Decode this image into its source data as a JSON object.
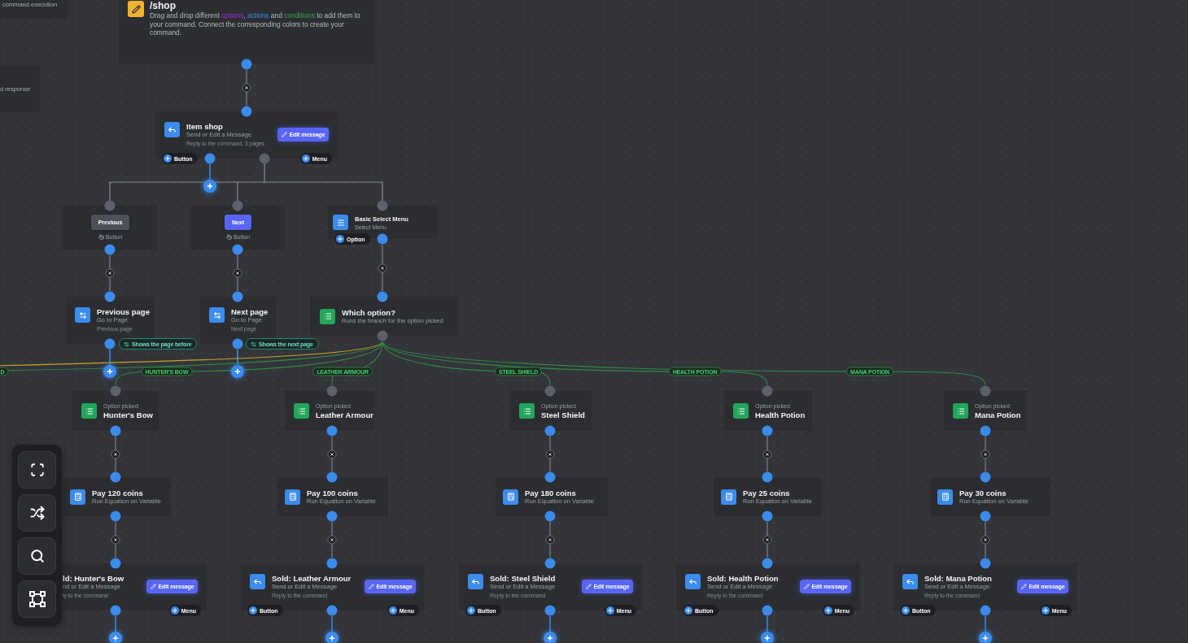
{
  "partial_nodes": [
    {
      "text": "command execution"
    },
    {
      "text": "d response"
    }
  ],
  "command": {
    "title": "/shop",
    "description": [
      {
        "kind": "text",
        "text": "Drag and drop different "
      },
      {
        "kind": "option",
        "text": "options"
      },
      {
        "kind": "text",
        "text": ", "
      },
      {
        "kind": "action",
        "text": "actions"
      },
      {
        "kind": "text",
        "text": " and "
      },
      {
        "kind": "condition",
        "text": "conditions"
      },
      {
        "kind": "text",
        "text": " to add them to your command. Connect the corresponding colors to create your command."
      }
    ]
  },
  "nodes": [
    {
      "kind": "message",
      "title": "Item shop",
      "subtitle": "Send or Edit a Message",
      "note": "Reply to the command, 3 pages",
      "edit_button": "Edit message",
      "button_pill": "Button",
      "menu_pill": "Menu"
    },
    {
      "kind": "button",
      "button": {
        "label": "Previous",
        "kind": "secondary"
      },
      "caption": "Button"
    },
    {
      "kind": "button",
      "button": {
        "label": "Next",
        "kind": "primary"
      },
      "caption": "Button"
    },
    {
      "kind": "select_menu",
      "title": "Basic Select Menu",
      "subtitle": "Select Menu",
      "option_pill": "Option"
    },
    {
      "kind": "action",
      "title": "Previous page",
      "subtitle": "Go to Page",
      "note": "Previous page"
    },
    {
      "kind": "action",
      "title": "Next page",
      "subtitle": "Go to Page",
      "note": "Next page"
    },
    {
      "kind": "condition",
      "title": "Which option?",
      "subtitle": "Runs the branch for the option picked"
    },
    {
      "kind": "option",
      "overline": "Option picked",
      "title": "Hunter's Bow"
    },
    {
      "kind": "option",
      "overline": "Option picked",
      "title": "Leather Armour"
    },
    {
      "kind": "option",
      "overline": "Option picked",
      "title": "Steel Shield"
    },
    {
      "kind": "option",
      "overline": "Option picked",
      "title": "Health Potion"
    },
    {
      "kind": "option",
      "overline": "Option picked",
      "title": "Mana Potion"
    },
    {
      "kind": "equation",
      "title": "Pay 120 coins",
      "subtitle": "Run Equation on Variable"
    },
    {
      "kind": "equation",
      "title": "Pay 100 coins",
      "subtitle": "Run Equation on Variable"
    },
    {
      "kind": "equation",
      "title": "Pay 180 coins",
      "subtitle": "Run Equation on Variable"
    },
    {
      "kind": "equation",
      "title": "Pay 25 coins",
      "subtitle": "Run Equation on Variable"
    },
    {
      "kind": "equation",
      "title": "Pay 30 coins",
      "subtitle": "Run Equation on Variable"
    },
    {
      "kind": "message",
      "title": "ld: Hunter's Bow",
      "subtitle": "nd or Edit a Message",
      "note": "ly to the command",
      "edit_button": "Edit message",
      "menu_pill": "Menu"
    },
    {
      "kind": "message",
      "title": "Sold: Leather Armour",
      "subtitle": "Send or Edit a Message",
      "note": "Reply to the command",
      "edit_button": "Edit message",
      "button_pill": "Button",
      "menu_pill": "Menu"
    },
    {
      "kind": "message",
      "title": "Sold: Steel Shield",
      "subtitle": "Send or Edit a Message",
      "note": "Reply to the command",
      "edit_button": "Edit message",
      "button_pill": "Button",
      "menu_pill": "Menu"
    },
    {
      "kind": "message",
      "title": "Sold: Health Potion",
      "subtitle": "Send or Edit a Message",
      "note": "Reply to the command",
      "edit_button": "Edit message",
      "button_pill": "Button",
      "menu_pill": "Menu"
    },
    {
      "kind": "message",
      "title": "Sold: Mana Potion",
      "subtitle": "Send or Edit a Message",
      "note": "Reply to the command",
      "edit_button": "Edit message",
      "button_pill": "Button",
      "menu_pill": "Menu"
    }
  ],
  "edge_labels": [
    {
      "kind": "action",
      "text": "Shows the page before"
    },
    {
      "kind": "action",
      "text": "Shows the next page"
    },
    {
      "kind": "option",
      "text": "D"
    },
    {
      "kind": "option",
      "text": "HUNTER'S BOW"
    },
    {
      "kind": "option",
      "text": "LEATHER ARMOUR"
    },
    {
      "kind": "option",
      "text": "STEEL SHIELD"
    },
    {
      "kind": "option",
      "text": "HEALTH POTION"
    },
    {
      "kind": "option",
      "text": "MANA POTION"
    }
  ]
}
